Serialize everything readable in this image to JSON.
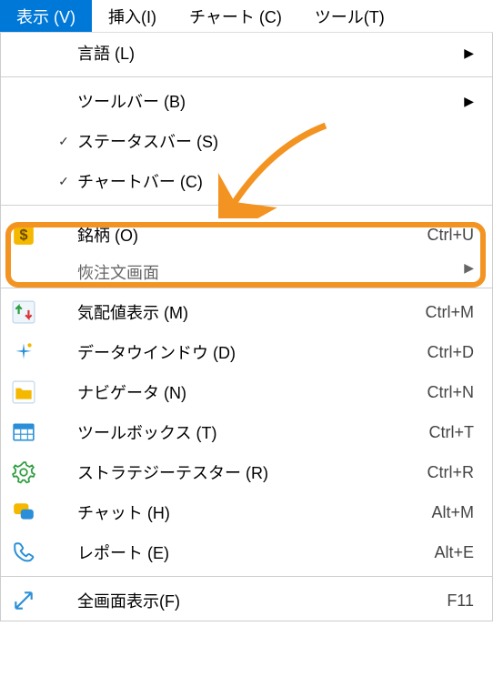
{
  "menubar": {
    "view": "表示 (V)",
    "insert": "挿入(I)",
    "chart": "チャート (C)",
    "tools": "ツール(T)"
  },
  "menu": {
    "language": "言語 (L)",
    "toolbar": "ツールバー (B)",
    "statusbar": "ステータスバー (S)",
    "chartbar": "チャートバー (C)",
    "symbols": {
      "label": "銘柄 (O)",
      "shortcut": "Ctrl+U"
    },
    "truncated": "恢注文画面",
    "marketwatch": {
      "label": "気配値表示 (M)",
      "shortcut": "Ctrl+M"
    },
    "datawindow": {
      "label": "データウインドウ (D)",
      "shortcut": "Ctrl+D"
    },
    "navigator": {
      "label": "ナビゲータ (N)",
      "shortcut": "Ctrl+N"
    },
    "toolbox": {
      "label": "ツールボックス (T)",
      "shortcut": "Ctrl+T"
    },
    "strategytester": {
      "label": "ストラテジーテスター (R)",
      "shortcut": "Ctrl+R"
    },
    "chat": {
      "label": "チャット (H)",
      "shortcut": "Alt+M"
    },
    "report": {
      "label": "レポート (E)",
      "shortcut": "Alt+E"
    },
    "fullscreen": {
      "label": "全画面表示(F)",
      "shortcut": "F11"
    }
  }
}
